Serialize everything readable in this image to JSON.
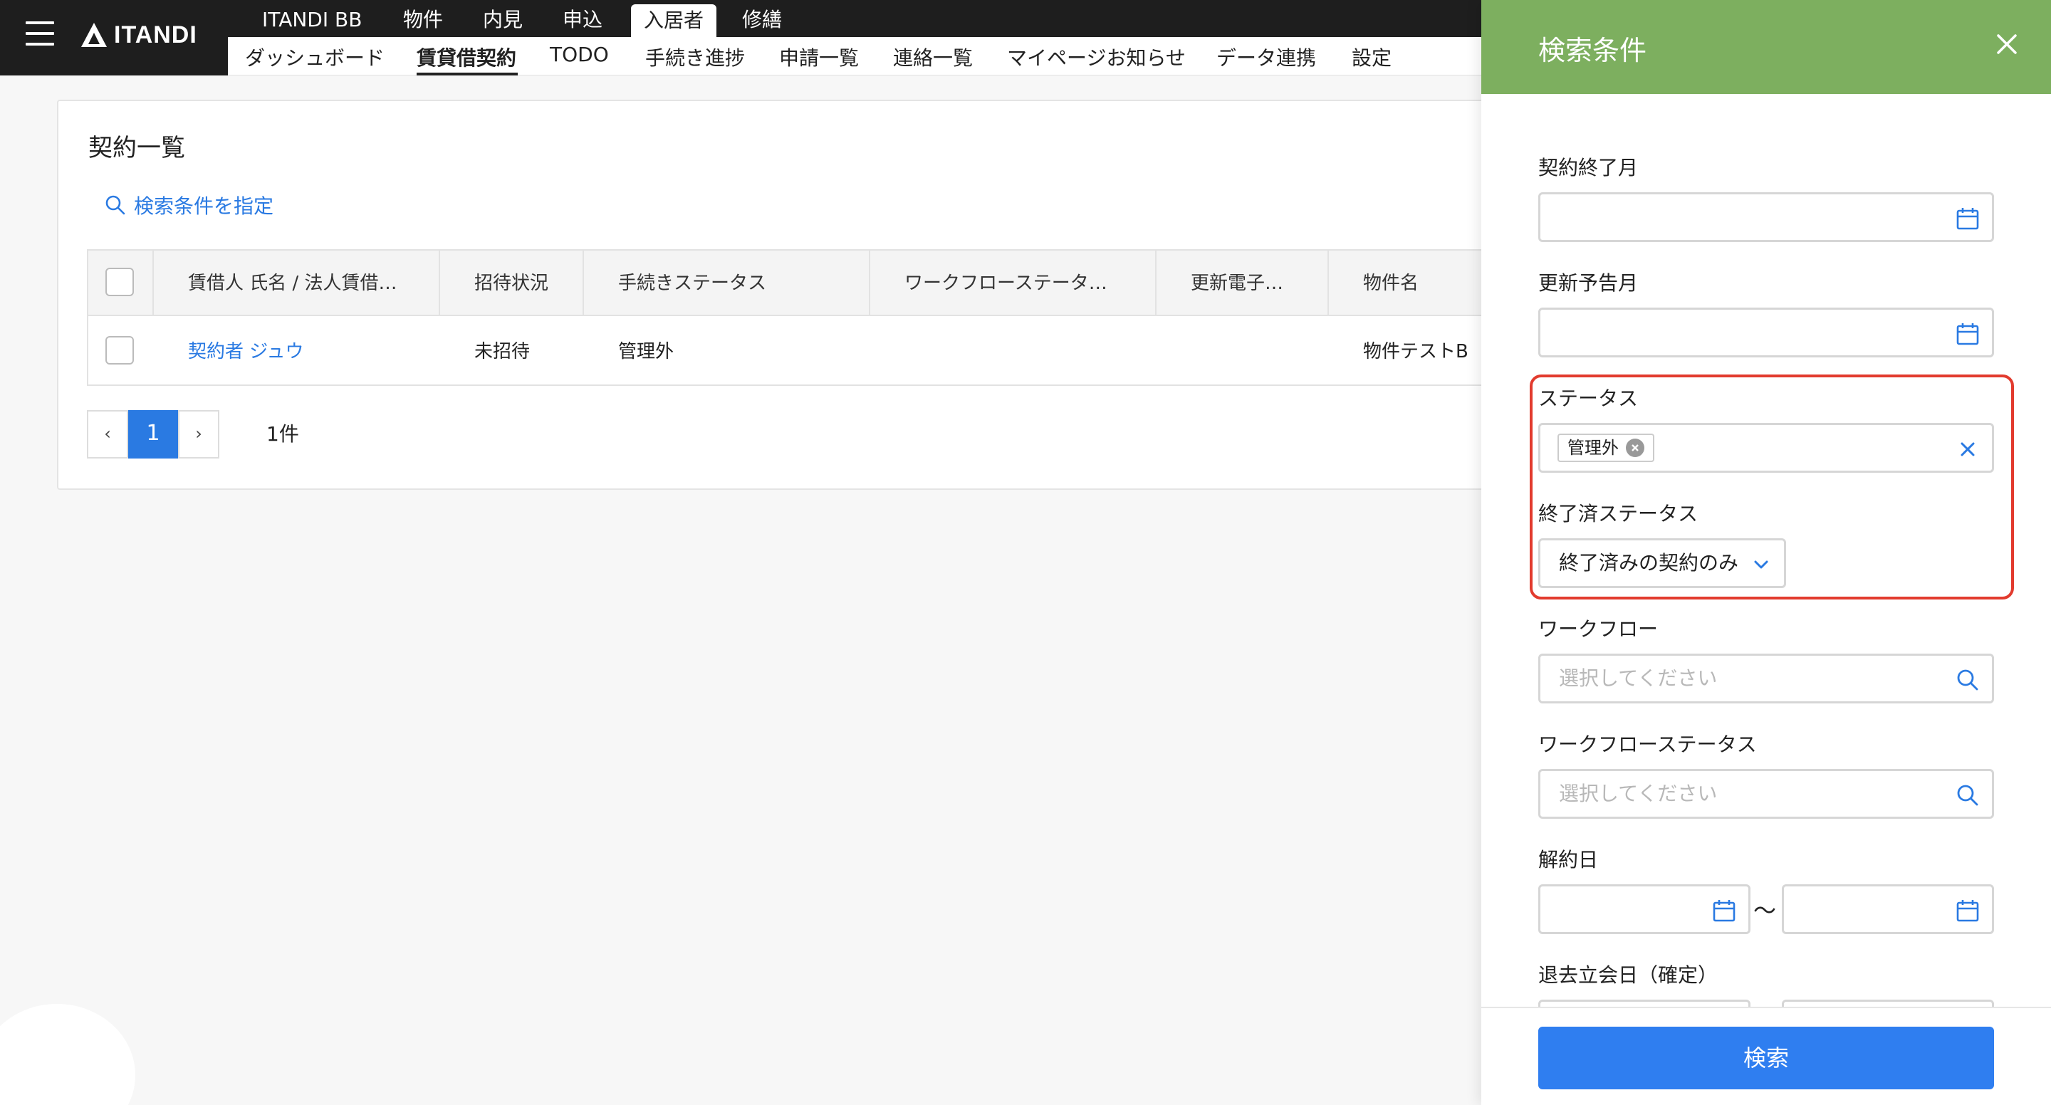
{
  "brand": {
    "name": "ITANDI"
  },
  "primary_nav": [
    {
      "label": "ITANDI BB",
      "active": false
    },
    {
      "label": "物件",
      "active": false
    },
    {
      "label": "内見",
      "active": false
    },
    {
      "label": "申込",
      "active": false
    },
    {
      "label": "入居者",
      "active": true
    },
    {
      "label": "修繕",
      "active": false
    }
  ],
  "secondary_nav": [
    {
      "label": "ダッシュボード",
      "active": false
    },
    {
      "label": "賃貸借契約",
      "active": true
    },
    {
      "label": "TODO",
      "active": false
    },
    {
      "label": "手続き進捗",
      "active": false
    },
    {
      "label": "申請一覧",
      "active": false
    },
    {
      "label": "連絡一覧",
      "active": false
    },
    {
      "label": "マイページお知らせ",
      "active": false
    },
    {
      "label": "データ連携",
      "active": false
    },
    {
      "label": "設定",
      "active": false
    }
  ],
  "main": {
    "title": "契約一覧",
    "search_link": "検索条件を指定",
    "table": {
      "columns": [
        "賃借人 氏名 / 法人賃借…",
        "招待状況",
        "手続きステータス",
        "ワークフローステータ…",
        "更新電子…",
        "物件名"
      ],
      "rows": [
        {
          "tenant": "契約者 ジュウ",
          "invite": "未招待",
          "procedure_status": "管理外",
          "workflow_status": "",
          "renewal": "",
          "property": "物件テストB"
        }
      ]
    },
    "pagination": {
      "prev": "‹",
      "current": "1",
      "next": "›",
      "count": "1件"
    }
  },
  "drawer": {
    "title": "検索条件",
    "fields": {
      "contract_end_month": {
        "label": "契約終了月",
        "value": ""
      },
      "renewal_notice_month": {
        "label": "更新予告月",
        "value": ""
      },
      "status": {
        "label": "ステータス",
        "chips": [
          "管理外"
        ]
      },
      "ended_status": {
        "label": "終了済ステータス",
        "selected": "終了済みの契約のみ"
      },
      "workflow": {
        "label": "ワークフロー",
        "placeholder": "選択してください"
      },
      "workflow_status": {
        "label": "ワークフローステータス",
        "placeholder": "選択してください"
      },
      "cancellation_date": {
        "label": "解約日",
        "separator": "〜"
      },
      "move_out_date": {
        "label": "退去立会日（確定）"
      }
    },
    "submit_label": "検索"
  },
  "colors": {
    "accent": "#2f7ef0",
    "drawer_header": "#7daf5f",
    "link": "#2a7ae2",
    "highlight": "#e23b2e",
    "dark_bar": "#1e1e1e"
  },
  "icons": [
    "hamburger-icon",
    "itandi-logo-icon",
    "search-icon",
    "close-icon",
    "calendar-icon",
    "chevron-down-icon",
    "chip-remove-icon",
    "clear-icon"
  ]
}
